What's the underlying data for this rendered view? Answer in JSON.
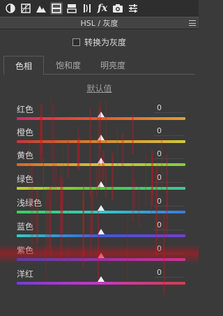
{
  "toolbar": {
    "tools": [
      {
        "icon": "basic-panel-icon"
      },
      {
        "icon": "tone-curve-grid-icon"
      },
      {
        "icon": "detail-mountain-icon"
      },
      {
        "icon": "hsl-panel-icon"
      },
      {
        "icon": "split-toning-icon"
      },
      {
        "icon": "lens-correction-icon"
      },
      {
        "icon": "effects-fx-icon",
        "text": "fx"
      },
      {
        "icon": "camera-calibration-icon"
      },
      {
        "icon": "presets-sliders-icon"
      }
    ],
    "active_index": 3
  },
  "panel": {
    "title": "HSL / 灰度"
  },
  "grayscale": {
    "label": "转换为灰度",
    "checked": false
  },
  "tabs": {
    "items": [
      "色相",
      "饱和度",
      "明亮度"
    ],
    "active_index": 0
  },
  "default_link": "默认值",
  "sliders": [
    {
      "label": "红色",
      "value": "0",
      "position": 0.5,
      "gradient": [
        "#d02a6a",
        "#e65b2a",
        "#d9a23a"
      ]
    },
    {
      "label": "橙色",
      "value": "0",
      "position": 0.5,
      "gradient": [
        "#c7343a",
        "#d98a2e",
        "#d8c83a"
      ]
    },
    {
      "label": "黄色",
      "value": "0",
      "position": 0.5,
      "gradient": [
        "#d46a2a",
        "#d9c53a",
        "#7fcf3a"
      ]
    },
    {
      "label": "绿色",
      "value": "0",
      "position": 0.5,
      "gradient": [
        "#c7c93a",
        "#4fcf3a",
        "#38c9a0"
      ]
    },
    {
      "label": "浅绿色",
      "value": "0",
      "position": 0.5,
      "gradient": [
        "#3ad05a",
        "#38c8c8",
        "#3a7ad8"
      ]
    },
    {
      "label": "蓝色",
      "value": "0",
      "position": 0.5,
      "gradient": [
        "#38c8c8",
        "#3a5cd8",
        "#7a3ad8"
      ]
    },
    {
      "label": "紫色",
      "value": "0",
      "position": 0.5,
      "gradient": [
        "#3a4ad8",
        "#8a3ad8",
        "#d83aa8"
      ]
    },
    {
      "label": "洋红",
      "value": "0",
      "position": 0.5,
      "gradient": [
        "#7a3ad8",
        "#c83ac0",
        "#d83a4a"
      ]
    }
  ],
  "colors": {
    "panel_bg": "#3a3a3a",
    "toolbar_bg": "#2e2e2e",
    "noise_overlay": "#d2141e"
  }
}
